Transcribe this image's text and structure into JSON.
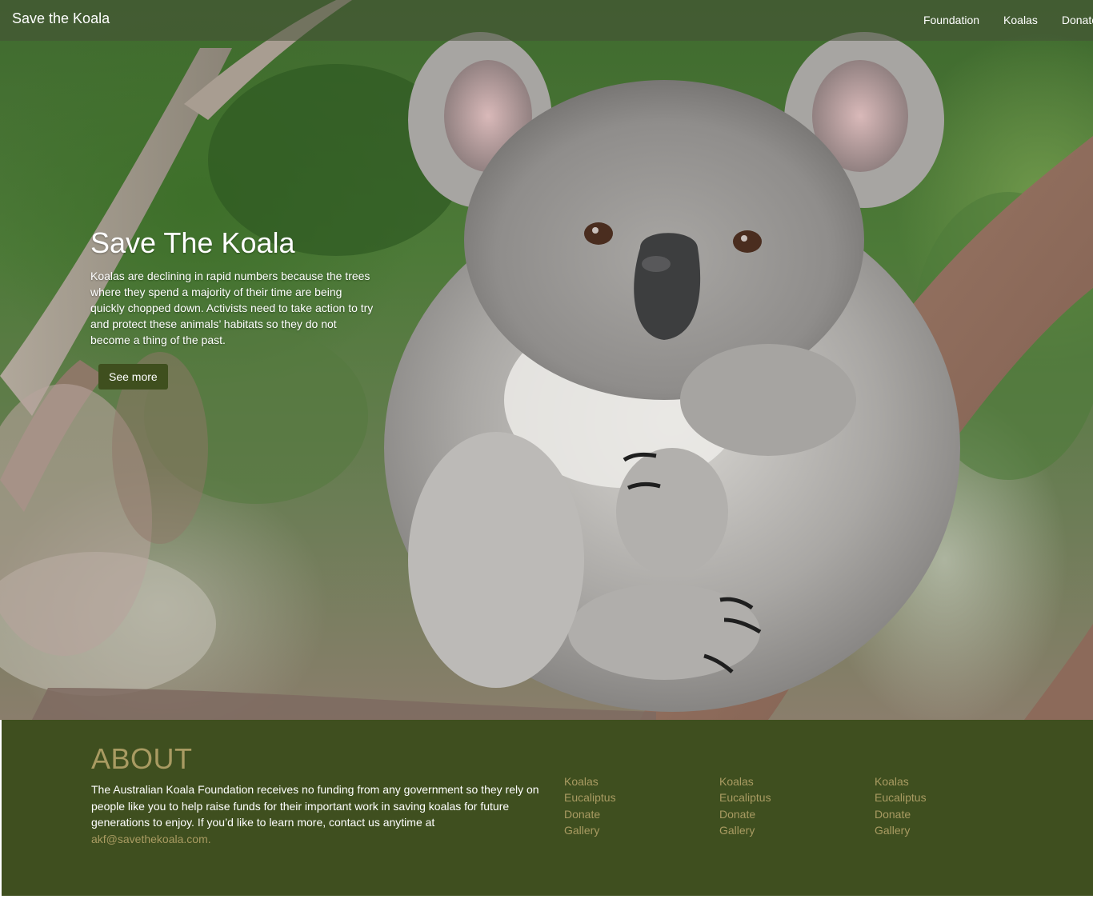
{
  "header": {
    "brand": "Save the Koala",
    "nav": [
      {
        "label": "Foundation"
      },
      {
        "label": "Koalas"
      },
      {
        "label": "Donate"
      }
    ]
  },
  "hero": {
    "title": "Save The Koala",
    "text": "Koalas are declining in rapid numbers because the trees where they spend a majority of their time are being quickly chopped down. Activists need to take action to try and protect these animals’ habitats so they do not become a thing of the past.",
    "button_label": "See more",
    "image_subject": "koala-photo"
  },
  "about": {
    "title": "ABOUT",
    "text": "The Australian Koala Foundation receives no funding from any government so they rely on people like you to help raise funds for their important work in saving koalas for future generations to enjoy. If you’d like to learn more, contact us anytime at",
    "email": "akf@savethekoala.com.",
    "link_columns": [
      {
        "links": [
          "Koalas",
          "Eucaliptus",
          "Donate",
          "Gallery"
        ]
      },
      {
        "links": [
          "Koalas",
          "Eucaliptus",
          "Donate",
          "Gallery"
        ]
      },
      {
        "links": [
          "Koalas",
          "Eucaliptus",
          "Donate",
          "Gallery"
        ]
      }
    ]
  },
  "colors": {
    "footer_bg": "#3f4f1f",
    "accent_gold": "#a99b62",
    "button_bg": "#3f4f1e"
  }
}
